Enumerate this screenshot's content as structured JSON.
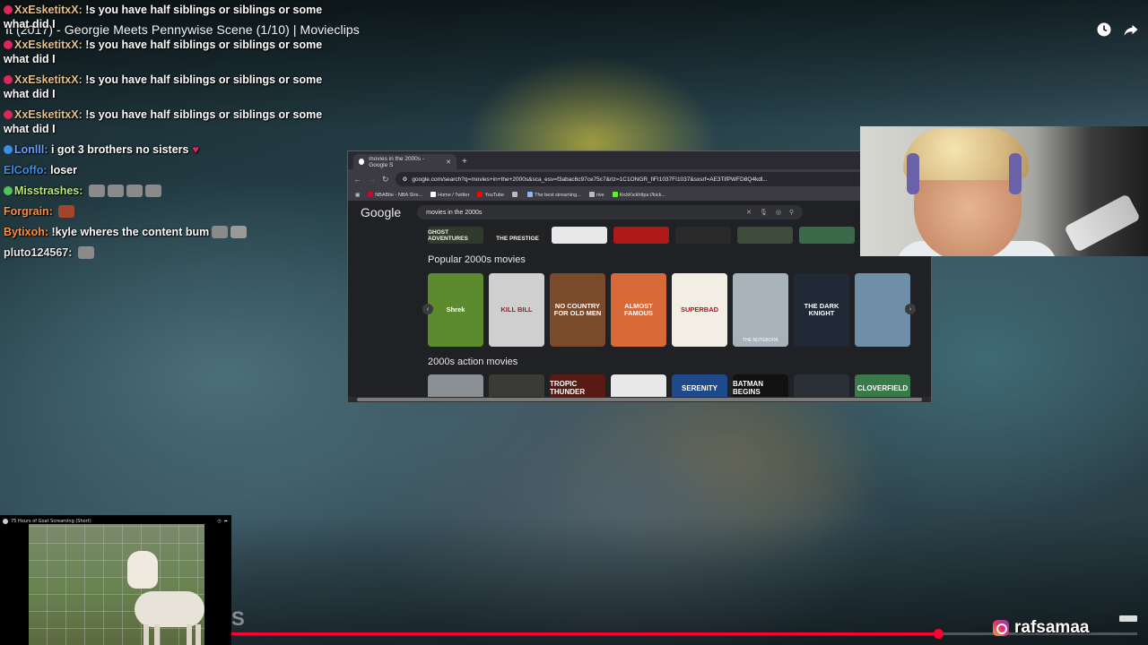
{
  "video": {
    "title": "It (2017) - Georgie Meets Pennywise Scene (1/10) | Movieclips",
    "progress_fraction": 0.78
  },
  "chat": [
    {
      "user": "XxEsketitxX:",
      "user_color": "#e3c08a",
      "badge_color": "#e0255a",
      "text": "!s you have half siblings or siblings or some what did I"
    },
    {
      "user": "XxEsketitxX:",
      "user_color": "#e3c08a",
      "badge_color": "#e0255a",
      "text": "!s you have half siblings or siblings or some what did I"
    },
    {
      "user": "XxEsketitxX:",
      "user_color": "#e3c08a",
      "badge_color": "#e0255a",
      "text": "!s you have half siblings or siblings or some what did I"
    },
    {
      "user": "XxEsketitxX:",
      "user_color": "#e3c08a",
      "badge_color": "#e0255a",
      "text": "!s you have half siblings or siblings or some what did I"
    },
    {
      "user": "Lonlll:",
      "user_color": "#6aa0ff",
      "badge_color": "#3a8ee6",
      "text": "i got 3 brothers no sisters"
    },
    {
      "user": "ElCoffo:",
      "user_color": "#3a8ee6",
      "badge_color": "",
      "text": "loser"
    },
    {
      "user": "Misstrashes:",
      "user_color": "#b7e67a",
      "badge_color": "#53c25c",
      "text": ""
    },
    {
      "user": "Forgrain:",
      "user_color": "#ff8c3a",
      "badge_color": "",
      "text": ""
    },
    {
      "user": "Bytixoh:",
      "user_color": "#ff8c3a",
      "badge_color": "",
      "text": "!kyle wheres the content bum"
    },
    {
      "user": "pluto124567:",
      "user_color": "#e8e8e8",
      "badge_color": "",
      "text": ""
    }
  ],
  "browser": {
    "tab_title": "movies in the 2000s - Google S",
    "new_tab": "+",
    "url": "google.com/search?q=movies+in+the+2000s&sca_esv=f3abac6c97ce75c7&rlz=1C1ONGR_fiFI1037FI1037&sxsrf=AE3TifPWFD8Q4kdl...",
    "bookmarks": [
      {
        "label": "NBABite - NBA Stre...",
        "color": "#c9082a"
      },
      {
        "label": "Home / Twitter",
        "color": "#ffffff"
      },
      {
        "label": "YouTube",
        "color": "#ff0000"
      },
      {
        "label": "",
        "color": "#bbbbbb"
      },
      {
        "label": "The best streaming...",
        "color": "#8ab4f8"
      },
      {
        "label": "rive",
        "color": "#bbbbbb"
      },
      {
        "label": "KickKickhttps://kick...",
        "color": "#53fc18"
      }
    ],
    "google_logo": "Google",
    "search_query": "movies in the 2000s",
    "top_strip": [
      "GHOST ADVENTURES",
      "THE PRESTIGE",
      "",
      "",
      "",
      "",
      ""
    ],
    "section1_title": "Popular 2000s movies",
    "popular": [
      {
        "label": "Shrek",
        "caption": "",
        "bg": "#5c8b2e"
      },
      {
        "label": "KILL BILL",
        "caption": "",
        "bg": "#cfcfcf"
      },
      {
        "label": "NO COUNTRY FOR OLD MEN",
        "caption": "",
        "bg": "#7a4a2a"
      },
      {
        "label": "ALMOST FAMOUS",
        "caption": "",
        "bg": "#d86a3a"
      },
      {
        "label": "SUPERBAD",
        "caption": "",
        "bg": "#f2eee4"
      },
      {
        "label": "",
        "caption": "THE NOTEBOOK",
        "bg": "#a7b3b8"
      },
      {
        "label": "THE DARK KNIGHT",
        "caption": "",
        "bg": "#1f2a36"
      },
      {
        "label": "",
        "caption": "",
        "bg": "#6f8fa8"
      }
    ],
    "section2_title": "2000s action movies",
    "action": [
      {
        "label": "",
        "bg": "#8a8f94"
      },
      {
        "label": "",
        "bg": "#3a3a36"
      },
      {
        "label": "TROPIC THUNDER",
        "bg": "#5a1a14"
      },
      {
        "label": "",
        "bg": "#e8e8e8"
      },
      {
        "label": "SERENITY",
        "bg": "#1e4a8c"
      },
      {
        "label": "BATMAN BEGINS",
        "bg": "#111111"
      },
      {
        "label": "",
        "bg": "#2a2f36"
      },
      {
        "label": "CLOVERFIELD",
        "bg": "#3a7a4a"
      }
    ]
  },
  "mini_player": {
    "title": "75 Hours of Goat Screaming (Short)",
    "overlay_letter": "S"
  },
  "instagram": {
    "handle": "rafsamaa"
  }
}
